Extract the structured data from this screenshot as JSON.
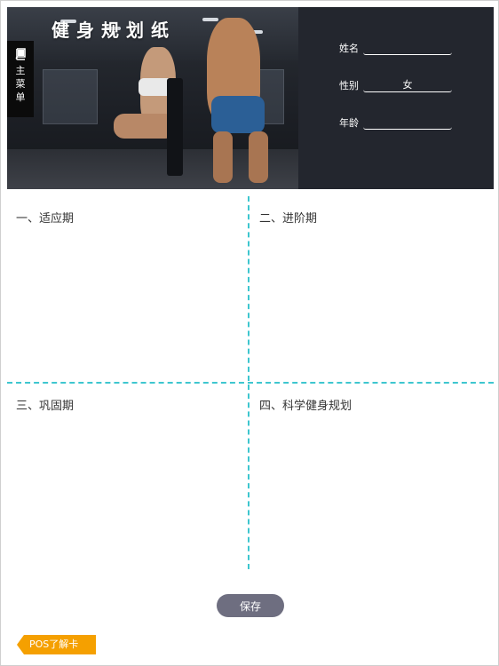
{
  "header": {
    "title": "健身规划纸",
    "menu_label": "主菜单",
    "menu_icon": "book-icon"
  },
  "profile": {
    "name_label": "姓名",
    "name_value": "",
    "gender_label": "性别",
    "gender_value": "女",
    "age_label": "年龄",
    "age_value": ""
  },
  "sections": [
    {
      "title": "一、适应期"
    },
    {
      "title": "二、进阶期"
    },
    {
      "title": "三、巩固期"
    },
    {
      "title": "四、科学健身规划"
    }
  ],
  "actions": {
    "save_label": "保存",
    "pos_label": "POS了解卡"
  },
  "colors": {
    "header_bg": "#23262e",
    "divider": "#3ec6cf",
    "save_button": "#6e6e80",
    "pos_button": "#f5a000"
  }
}
